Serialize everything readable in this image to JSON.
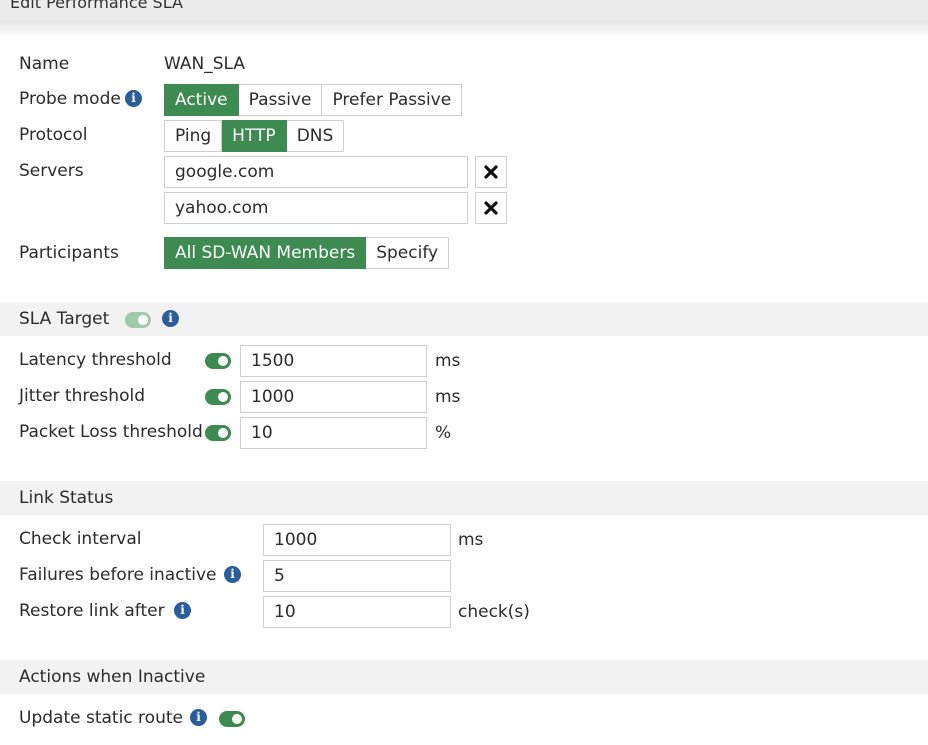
{
  "header": {
    "title": "Edit Performance SLA"
  },
  "general": {
    "name_label": "Name",
    "name_value": "WAN_SLA",
    "probe_mode_label": "Probe mode",
    "probe_mode_options": [
      "Active",
      "Passive",
      "Prefer Passive"
    ],
    "probe_mode_selected": "Active",
    "protocol_label": "Protocol",
    "protocol_options": [
      "Ping",
      "HTTP",
      "DNS"
    ],
    "protocol_selected": "HTTP",
    "servers_label": "Servers",
    "servers": [
      "google.com",
      "yahoo.com"
    ],
    "participants_label": "Participants",
    "participants_options": [
      "All SD-WAN Members",
      "Specify"
    ],
    "participants_selected": "All SD-WAN Members"
  },
  "sla_target": {
    "title": "SLA Target",
    "enabled": true,
    "latency_label": "Latency threshold",
    "latency_value": "1500",
    "latency_unit": "ms",
    "jitter_label": "Jitter threshold",
    "jitter_value": "1000",
    "jitter_unit": "ms",
    "packet_loss_label": "Packet Loss threshold",
    "packet_loss_value": "10",
    "packet_loss_unit": "%"
  },
  "link_status": {
    "title": "Link Status",
    "check_interval_label": "Check interval",
    "check_interval_value": "1000",
    "check_interval_unit": "ms",
    "failures_label": "Failures before inactive",
    "failures_value": "5",
    "restore_label": "Restore link after",
    "restore_value": "10",
    "restore_unit": "check(s)"
  },
  "actions": {
    "title": "Actions when Inactive",
    "update_static_route_label": "Update static route",
    "update_static_route_enabled": true
  },
  "colors": {
    "accent": "#3d8b50",
    "info": "#2a5d9a",
    "section_bg": "#f2f2f2"
  },
  "icons": [
    "info-icon",
    "close-icon",
    "toggle-switch"
  ]
}
